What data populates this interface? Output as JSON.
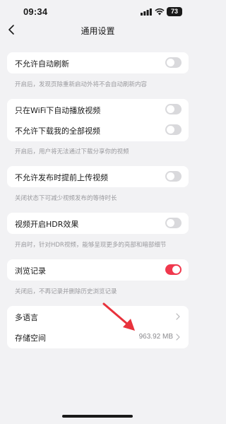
{
  "status": {
    "time": "09:34",
    "battery": "73"
  },
  "header": {
    "title": "通用设置"
  },
  "sections": {
    "refresh": {
      "label": "不允许自动刷新",
      "desc": "开启后，发现页除重新启动外将不会自动刷新内容",
      "on": false
    },
    "wifi_play": {
      "label": "只在WiFi下自动播放视频",
      "on": false
    },
    "no_download": {
      "label": "不允许下载我的全部视频",
      "on": false
    },
    "download_desc": "开启后，用户将无法通过下载分享你的视频",
    "pre_upload": {
      "label": "不允许发布时提前上传视频",
      "desc": "关闭状态下可减少视频发布的等待时长",
      "on": false
    },
    "hdr": {
      "label": "视频开启HDR效果",
      "desc": "开启时，针对HDR视频，能够呈现更多的亮部和暗部细节",
      "on": false
    },
    "history": {
      "label": "浏览记录",
      "desc": "关闭后，不再记录并删除历史浏览记录",
      "on": true
    },
    "language": {
      "label": "多语言"
    },
    "storage": {
      "label": "存储空间",
      "value": "963.92 MB"
    }
  },
  "colors": {
    "accent": "#f0384d",
    "toggle_off": "#d9d9dc",
    "background": "#f2f2f4",
    "annotation_arrow": "#e8323c"
  },
  "icons": {
    "back": "chevron-left-icon",
    "row_arrow": "chevron-right-icon",
    "wifi": "wifi-icon",
    "signal": "cellular-signal-icon"
  }
}
